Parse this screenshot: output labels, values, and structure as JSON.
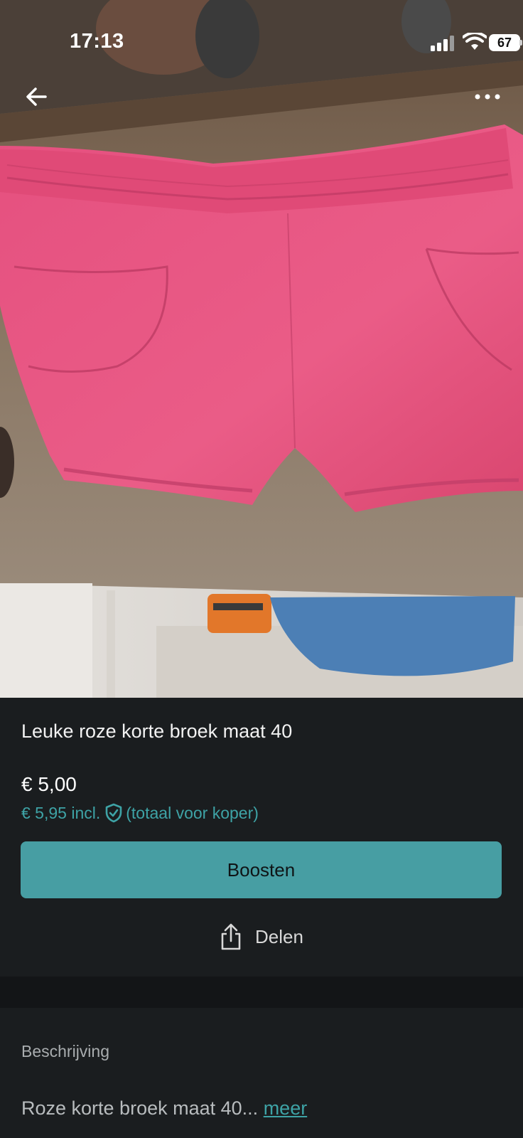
{
  "status_bar": {
    "time": "17:13",
    "battery": "67"
  },
  "icons": {
    "back": "arrow-left-icon",
    "more": "ellipsis-icon",
    "signal": "cellular-signal-icon",
    "wifi": "wifi-icon",
    "shield": "shield-check-icon",
    "share": "share-icon"
  },
  "product": {
    "title": "Leuke roze korte broek maat 40",
    "price": "€ 5,00",
    "price_incl_amount": "€ 5,95 incl.",
    "price_incl_note": "(totaal voor koper)"
  },
  "actions": {
    "boost_label": "Boosten",
    "share_label": "Delen"
  },
  "description": {
    "heading": "Beschrijving",
    "text": "Roze korte broek maat 40...",
    "more_label": "meer"
  },
  "colors": {
    "background": "#1a1d1f",
    "accent": "#479ea3",
    "accent_text": "#3ea3a6",
    "product_pink": "#e34f7d"
  }
}
